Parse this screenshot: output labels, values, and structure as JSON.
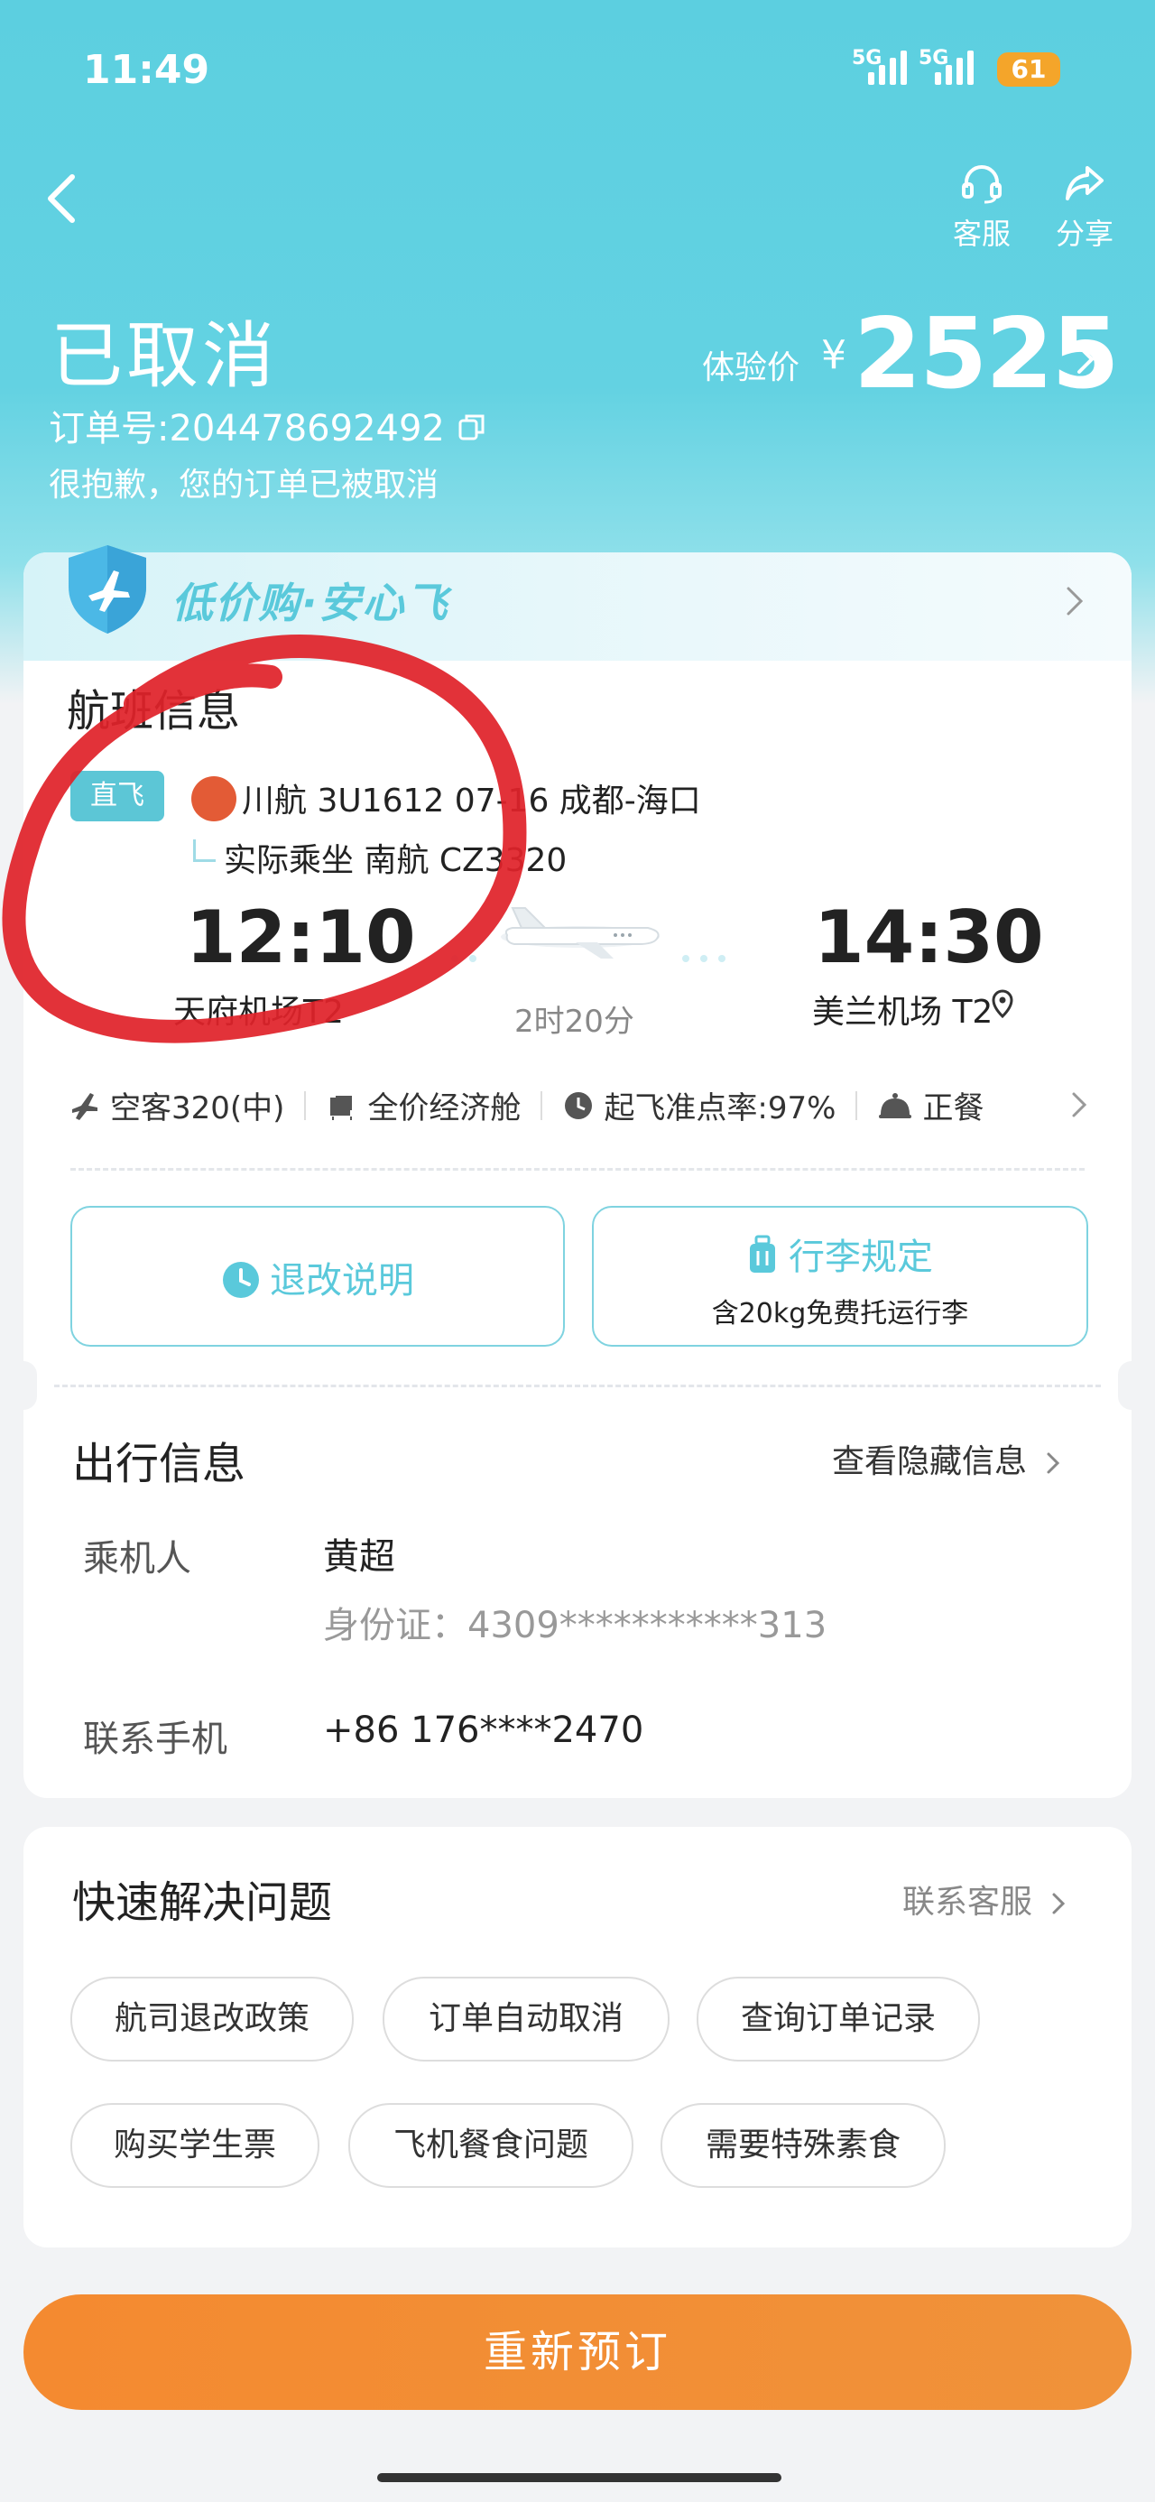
{
  "status_bar": {
    "time": "11:49",
    "signal1": "5G",
    "signal2": "5G",
    "battery": "61"
  },
  "header": {
    "service_label": "客服",
    "share_label": "分享",
    "order_status": "已取消",
    "order_number": "订单号:204478692492",
    "cancel_message": "很抱歉，您的订单已被取消",
    "price_label": "体验价",
    "price_currency": "¥",
    "price_value": "2525"
  },
  "banner": {
    "text": "低价购·安心飞"
  },
  "flight": {
    "section_title": "航班信息",
    "direct_tag": "直飞",
    "flight_line": "川航 3U1612  07-16 成都-海口",
    "actual_line": "实际乘坐  南航 CZ3320",
    "departure_time": "12:10",
    "arrival_time": "14:30",
    "departure_airport": "天府机场T2",
    "arrival_airport": "美兰机场 T2",
    "duration": "2时20分",
    "aircraft": "空客320(中)",
    "cabin": "全价经济舱",
    "on_time": "起飞准点率:97%",
    "meal": "正餐",
    "refund_button": "退改说明",
    "baggage_button": "行李规定",
    "baggage_sub": "含20kg免费托运行李"
  },
  "travel": {
    "section_title": "出行信息",
    "view_hidden": "查看隐藏信息",
    "passenger_label": "乘机人",
    "passenger_name": "黄超",
    "id_line": "身份证：4309***********313",
    "phone_label": "联系手机",
    "phone_value": "+86 176****2470"
  },
  "help": {
    "section_title": "快速解决问题",
    "contact_service": "联系客服",
    "chips": [
      "航司退改政策",
      "订单自动取消",
      "查询订单记录",
      "购买学生票",
      "飞机餐食问题",
      "需要特殊素食"
    ]
  },
  "rebook_button": "重新预订",
  "colors": {
    "header": "#5ccfe0",
    "accent": "#5ac9db",
    "cta": "#f48a30",
    "marker": "#e0222a"
  }
}
